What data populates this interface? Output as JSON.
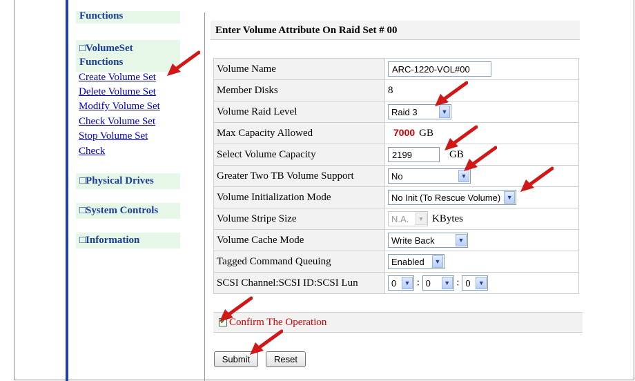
{
  "sidebar": {
    "functions_label": "Functions",
    "volumeset_label": "□VolumeSet",
    "volumeset_functions_label": "Functions",
    "links": [
      "Create Volume Set",
      "Delete Volume Set",
      "Modify Volume Set",
      "Check Volume Set",
      "Stop Volume Set",
      "Check"
    ],
    "physical_drives_label": "□Physical Drives",
    "system_controls_label": "□System Controls",
    "information_label": "□Information"
  },
  "main": {
    "title": "Enter Volume Attribute On Raid Set # 00",
    "rows": {
      "volume_name": {
        "label": "Volume Name",
        "value": "ARC-1220-VOL#00"
      },
      "member_disks": {
        "label": "Member Disks",
        "value": "8"
      },
      "raid_level": {
        "label": "Volume Raid Level",
        "value": "Raid 3"
      },
      "max_capacity": {
        "label": "Max Capacity Allowed",
        "value": "7000",
        "unit": "GB"
      },
      "select_capacity": {
        "label": "Select Volume Capacity",
        "value": "2199",
        "unit": "GB"
      },
      "two_tb_support": {
        "label": "Greater Two TB Volume Support",
        "value": "No"
      },
      "init_mode": {
        "label": "Volume Initialization Mode",
        "value": "No Init (To Rescue Volume)"
      },
      "stripe_size": {
        "label": "Volume Stripe Size",
        "value": "N.A.",
        "unit": "KBytes"
      },
      "cache_mode": {
        "label": "Volume Cache Mode",
        "value": "Write Back"
      },
      "tcq": {
        "label": "Tagged Command Queuing",
        "value": "Enabled"
      },
      "scsi": {
        "label": "SCSI Channel:SCSI ID:SCSI Lun",
        "channel": "0",
        "id": "0",
        "lun": "0",
        "sep": ":"
      }
    },
    "confirm": {
      "label": "Confirm The Operation",
      "checked": true
    },
    "buttons": {
      "submit": "Submit",
      "reset": "Reset"
    }
  },
  "colors": {
    "accent_bar": "#1c3fb8",
    "section_bg": "#e7f7e7",
    "link": "#0000cc",
    "warning_red": "#cc0000",
    "annotation_arrow": "#d01818"
  },
  "icons": {
    "dropdown": "chevron-down-icon",
    "checkbox": "checkmark-icon",
    "annotation": "red-arrow-icon"
  }
}
